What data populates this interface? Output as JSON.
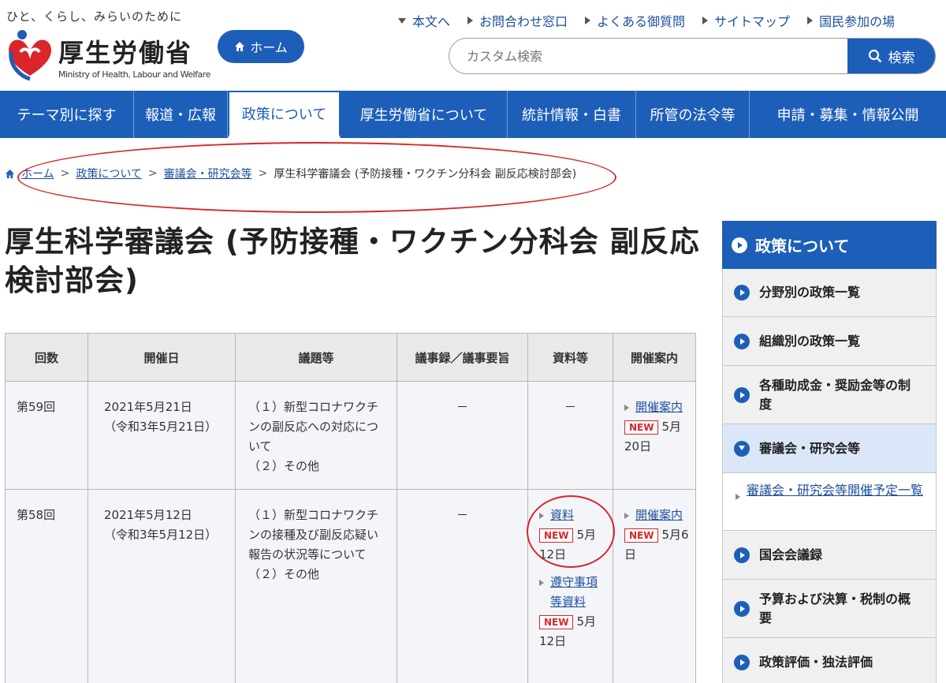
{
  "header": {
    "tagline": "ひと、くらし、みらいのために",
    "org_name": "厚生労働省",
    "org_name_en": "Ministry of Health, Labour and Welfare",
    "home_label": "ホーム",
    "utility": [
      {
        "label": "本文へ",
        "icon": "triangle-down"
      },
      {
        "label": "お問合わせ窓口",
        "icon": "triangle-right"
      },
      {
        "label": "よくある御質問",
        "icon": "triangle-right"
      },
      {
        "label": "サイトマップ",
        "icon": "triangle-right"
      },
      {
        "label": "国民参加の場",
        "icon": "triangle-right"
      }
    ],
    "search": {
      "placeholder": "カスタム検索",
      "button_label": "検索"
    }
  },
  "nav": [
    {
      "label": "テーマ別に探す"
    },
    {
      "label": "報道・広報"
    },
    {
      "label": "政策について",
      "active": true
    },
    {
      "label": "厚生労働省について"
    },
    {
      "label": "統計情報・白書"
    },
    {
      "label": "所管の法令等"
    },
    {
      "label": "申請・募集・情報公開"
    }
  ],
  "breadcrumb": {
    "items": [
      "ホーム",
      "政策について",
      "審議会・研究会等"
    ],
    "current": "厚生科学審議会 (予防接種・ワクチン分科会 副反応検討部会)",
    "separator": ">"
  },
  "page_title": "厚生科学審議会 (予防接種・ワクチン分科会 副反応検討部会)",
  "table": {
    "headers": [
      "回数",
      "開催日",
      "議題等",
      "議事録／議事要旨",
      "資料等",
      "開催案内"
    ],
    "rows": [
      {
        "num": "第59回",
        "date": "2021年5月21日",
        "date_wareki": "（令和3年5月21日）",
        "topics": "（１）新型コロナワクチンの副反応への対応について\n（２）その他",
        "minutes": "－",
        "materials": "－",
        "notice": {
          "link": "開催案内",
          "badge": "NEW",
          "date": "5月20日"
        }
      },
      {
        "num": "第58回",
        "date": "2021年5月12日",
        "date_wareki": "（令和3年5月12日）",
        "topics": "（１）新型コロナワクチンの接種及び副反応疑い報告の状況等について\n（２）その他",
        "minutes": "－",
        "materials_items": [
          {
            "link": "資料",
            "badge": "NEW",
            "date": "5月12日"
          },
          {
            "link": "遵守事項等資料",
            "badge": "NEW",
            "date": "5月12日"
          }
        ],
        "notice": {
          "link": "開催案内",
          "badge": "NEW",
          "date": "5月6日"
        }
      }
    ]
  },
  "sidebar": {
    "title": "政策について",
    "items": [
      {
        "label": "分野別の政策一覧"
      },
      {
        "label": "組織別の政策一覧"
      },
      {
        "label": "各種助成金・奨励金等の制度"
      },
      {
        "label": "審議会・研究会等",
        "active": true
      },
      {
        "label": "国会会議録"
      },
      {
        "label": "予算および決算・税制の概要"
      },
      {
        "label": "政策評価・独法評価"
      }
    ],
    "sub_item": "審議会・研究会等開催予定一覧"
  },
  "colors": {
    "primary": "#1d5fb8",
    "alert": "#d9252b",
    "link": "#1d4f9c"
  }
}
